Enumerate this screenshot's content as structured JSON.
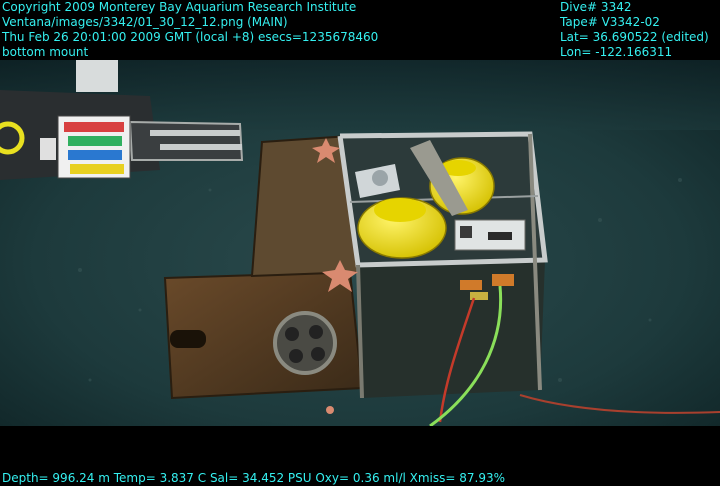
{
  "overlay": {
    "top_left": [
      "Copyright 2009 Monterey Bay Aquarium Research Institute",
      "Ventana/images/3342/01_30_12_12.png (MAIN)",
      "Thu Feb 26 20:01:00 2009 GMT (local +8)  esecs=1235678460",
      "bottom mount"
    ],
    "top_right": [
      "Dive# 3342",
      "Tape# V3342-02",
      "Lat= 36.690522 (edited)",
      "Lon= -122.166311"
    ],
    "bottom": "Depth= 996.24 m  Temp= 3.837 C  Sal= 34.452 PSU  Oxy= 0.36 ml/l  Xmiss= 87.93%"
  },
  "colors": {
    "overlay_text": "#35f0f0",
    "seafloor": "#1d3a3c",
    "buoy_yellow": "#f0e20a",
    "rust": "#5a4024",
    "sea_star": "#d98a70",
    "cable_green": "#8adf5a",
    "cable_red": "#c43a2a"
  },
  "scene": {
    "description_icons": [
      "rov-manipulator-arm",
      "color-calibration-card",
      "instrument-frame",
      "yellow-float",
      "sea-star",
      "green-cable",
      "red-cable"
    ]
  }
}
